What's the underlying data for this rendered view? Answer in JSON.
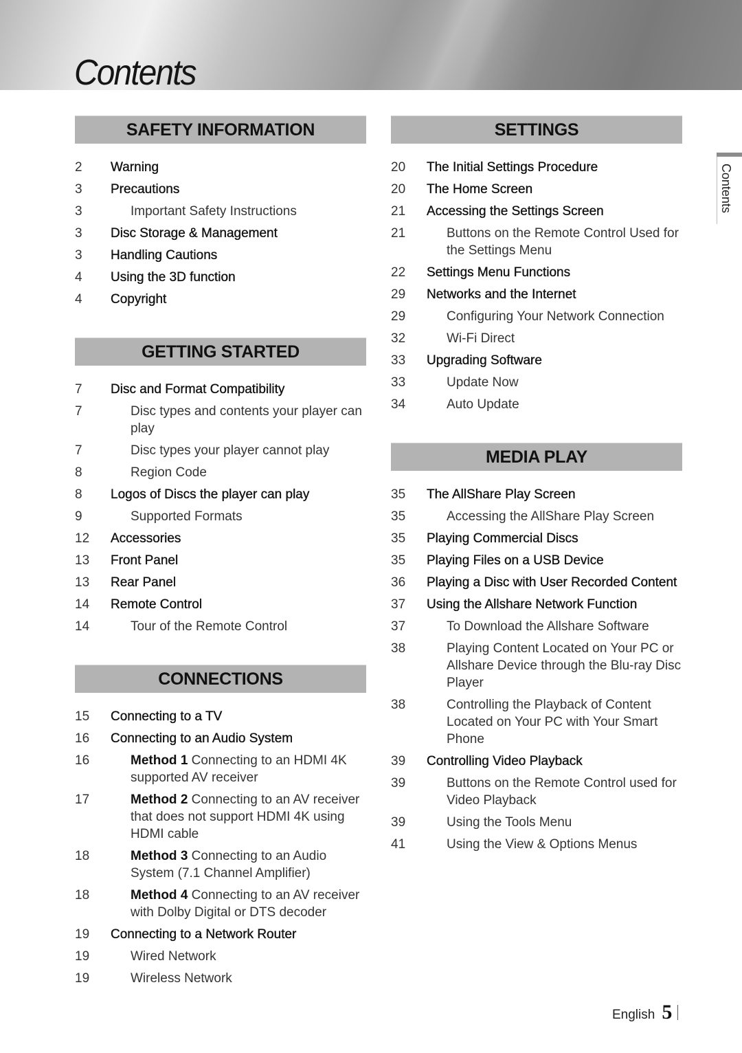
{
  "header": {
    "title": "Contents"
  },
  "side_label": "Contents",
  "footer": {
    "language": "English",
    "page": "5"
  },
  "left_column": [
    {
      "heading": "SAFETY INFORMATION",
      "entries": [
        {
          "page": "2",
          "level": 1,
          "text": "Warning"
        },
        {
          "page": "3",
          "level": 1,
          "text": "Precautions"
        },
        {
          "page": "3",
          "level": 2,
          "text": "Important Safety Instructions"
        },
        {
          "page": "3",
          "level": 1,
          "text": "Disc Storage & Management"
        },
        {
          "page": "3",
          "level": 1,
          "text": "Handling Cautions"
        },
        {
          "page": "4",
          "level": 1,
          "text": "Using the 3D function"
        },
        {
          "page": "4",
          "level": 1,
          "text": "Copyright"
        }
      ]
    },
    {
      "heading": "GETTING STARTED",
      "entries": [
        {
          "page": "7",
          "level": 1,
          "text": "Disc and Format Compatibility"
        },
        {
          "page": "7",
          "level": 2,
          "text": "Disc types and contents your player can play"
        },
        {
          "page": "7",
          "level": 2,
          "text": "Disc types your player cannot play"
        },
        {
          "page": "8",
          "level": 2,
          "text": "Region Code"
        },
        {
          "page": "8",
          "level": 1,
          "text": "Logos of Discs the player can play"
        },
        {
          "page": "9",
          "level": 2,
          "text": "Supported Formats"
        },
        {
          "page": "12",
          "level": 1,
          "text": "Accessories"
        },
        {
          "page": "13",
          "level": 1,
          "text": "Front Panel"
        },
        {
          "page": "13",
          "level": 1,
          "text": "Rear Panel"
        },
        {
          "page": "14",
          "level": 1,
          "text": "Remote Control"
        },
        {
          "page": "14",
          "level": 2,
          "text": "Tour of the Remote Control"
        }
      ]
    },
    {
      "heading": "CONNECTIONS",
      "entries": [
        {
          "page": "15",
          "level": 1,
          "text": "Connecting to a TV"
        },
        {
          "page": "16",
          "level": 1,
          "text": "Connecting to an Audio System"
        },
        {
          "page": "16",
          "level": 2,
          "bold": "Method 1",
          "text": " Connecting to an HDMI 4K supported AV receiver"
        },
        {
          "page": "17",
          "level": 2,
          "bold": "Method 2",
          "text": " Connecting to an AV receiver that does not support HDMI 4K using HDMI cable"
        },
        {
          "page": "18",
          "level": 2,
          "bold": "Method 3",
          "text": " Connecting to an Audio System (7.1 Channel Amplifier)"
        },
        {
          "page": "18",
          "level": 2,
          "bold": "Method 4",
          "text": " Connecting to an AV receiver with Dolby Digital or DTS decoder"
        },
        {
          "page": "19",
          "level": 1,
          "text": "Connecting to a Network Router"
        },
        {
          "page": "19",
          "level": 2,
          "text": "Wired Network"
        },
        {
          "page": "19",
          "level": 2,
          "text": "Wireless Network"
        }
      ]
    }
  ],
  "right_column": [
    {
      "heading": "SETTINGS",
      "entries": [
        {
          "page": "20",
          "level": 1,
          "text": "The Initial Settings Procedure"
        },
        {
          "page": "20",
          "level": 1,
          "text": "The Home Screen"
        },
        {
          "page": "21",
          "level": 1,
          "text": "Accessing the Settings Screen"
        },
        {
          "page": "21",
          "level": 2,
          "text": "Buttons on the Remote Control Used for the Settings Menu"
        },
        {
          "page": "22",
          "level": 1,
          "text": "Settings Menu Functions"
        },
        {
          "page": "29",
          "level": 1,
          "text": "Networks and the Internet"
        },
        {
          "page": "29",
          "level": 2,
          "text": "Configuring Your Network Connection"
        },
        {
          "page": "32",
          "level": 2,
          "text": "Wi-Fi Direct"
        },
        {
          "page": "33",
          "level": 1,
          "text": "Upgrading Software"
        },
        {
          "page": "33",
          "level": 2,
          "text": "Update Now"
        },
        {
          "page": "34",
          "level": 2,
          "text": "Auto Update"
        }
      ]
    },
    {
      "heading": "MEDIA PLAY",
      "entries": [
        {
          "page": "35",
          "level": 1,
          "text": "The AllShare Play Screen"
        },
        {
          "page": "35",
          "level": 2,
          "text": "Accessing the AllShare Play Screen"
        },
        {
          "page": "35",
          "level": 1,
          "text": "Playing Commercial Discs"
        },
        {
          "page": "35",
          "level": 1,
          "text": "Playing Files on a USB Device"
        },
        {
          "page": "36",
          "level": 1,
          "text": "Playing a Disc with User Recorded Content"
        },
        {
          "page": "37",
          "level": 1,
          "text": "Using the Allshare Network Function"
        },
        {
          "page": "37",
          "level": 2,
          "text": "To Download the Allshare Software"
        },
        {
          "page": "38",
          "level": 2,
          "text": "Playing Content Located on Your PC or Allshare Device through the Blu-ray Disc Player"
        },
        {
          "page": "38",
          "level": 2,
          "text": "Controlling the Playback of Content Located on Your PC with Your Smart Phone"
        },
        {
          "page": "39",
          "level": 1,
          "text": "Controlling Video Playback"
        },
        {
          "page": "39",
          "level": 2,
          "text": "Buttons on the Remote Control used for Video Playback"
        },
        {
          "page": "39",
          "level": 2,
          "text": "Using the Tools Menu"
        },
        {
          "page": "41",
          "level": 2,
          "text": "Using the View & Options Menus"
        }
      ]
    }
  ]
}
